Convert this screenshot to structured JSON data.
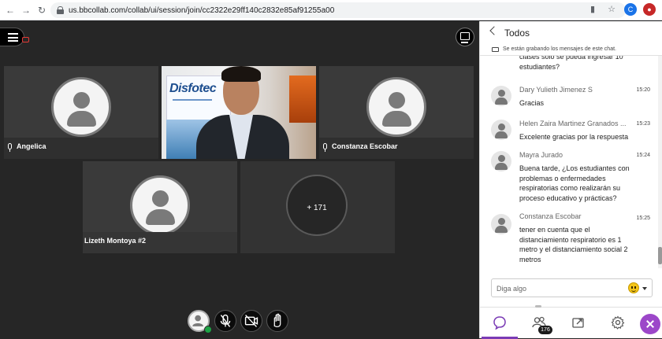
{
  "browser": {
    "url": "us.bbcollab.com/collab/ui/session/join/cc2322e29ff140c2832e85af91255a00",
    "profile_initial": "C"
  },
  "stage": {
    "tiles": [
      {
        "name": "Angelica"
      },
      {
        "name": "Constanza Escobar"
      },
      {
        "name": "Lizeth Montoya #2"
      }
    ],
    "video_banner_text": "Disfotec",
    "more_count": "+ 171"
  },
  "chat": {
    "title": "Todos",
    "recording_notice": "Se están grabando los mensajes de este chat.",
    "messages": [
      {
        "author": "",
        "time": "",
        "text": "clases solo se pueda ingresar 10 estudiantes?"
      },
      {
        "author": "Dary Yulieth Jimenez S",
        "time": "15:20",
        "text": "Gracias"
      },
      {
        "author": "Helen Zaira Martinez Granados ...",
        "time": "15:23",
        "text": "Excelente gracias por la respuesta"
      },
      {
        "author": "Mayra Jurado",
        "time": "15:24",
        "text": "Buena tarde, ¿Los estudiantes con problemas o enfermedades respiratorias como realizarán su proceso educativo y prácticas?"
      },
      {
        "author": "Constanza Escobar",
        "time": "15:25",
        "text": "tener en cuenta que el distanciamiento respiratorio es 1 metro  y el  distanciamiento social 2 metros"
      }
    ],
    "input_placeholder": "Diga algo"
  },
  "tabs": {
    "attendees_count": "176"
  },
  "colors": {
    "accent": "#7a3bb5",
    "close_button": "#9c47c9",
    "status_green": "#1ea446",
    "stage_bg": "#262626"
  }
}
